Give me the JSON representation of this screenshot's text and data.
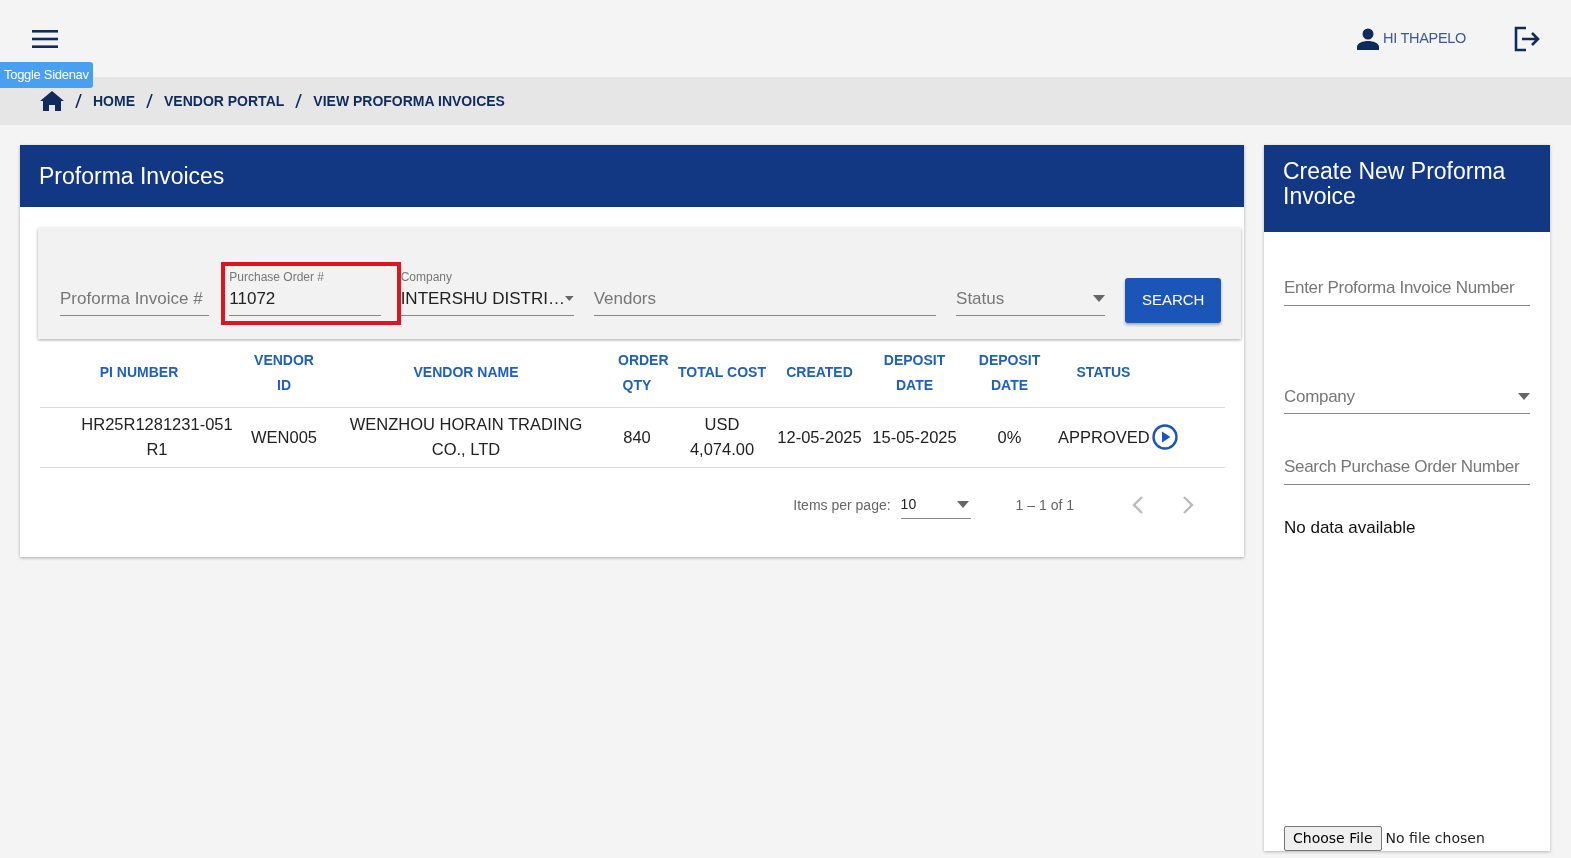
{
  "topbar": {
    "tooltip": "Toggle Sidenav",
    "user": "HI THAPELO"
  },
  "breadcrumb": [
    "HOME",
    "VENDOR PORTAL",
    "VIEW PROFORMA INVOICES"
  ],
  "invoices": {
    "title": "Proforma Invoices",
    "filters": [
      {
        "kind": "input",
        "placeholder": "Proforma Invoice #",
        "highlighted": false
      },
      {
        "kind": "input",
        "label": "Purchase Order #",
        "value": "11072",
        "highlighted": true
      },
      {
        "kind": "select",
        "label": "Company",
        "value": "INTERSHU DISTRI…",
        "highlighted": false
      },
      {
        "kind": "input",
        "placeholder": "Vendors",
        "highlighted": false
      },
      {
        "kind": "select",
        "placeholder": "Status",
        "highlighted": false
      }
    ],
    "search_button": "SEARCH",
    "table": {
      "columns": [
        "PI NUMBER",
        "VENDOR ID",
        "VENDOR NAME",
        "ORDER QTY",
        "TOTAL COST",
        "CREATED",
        "DEPOSIT DATE",
        "DEPOSIT DATE",
        "STATUS"
      ],
      "rows": [
        {
          "cells": [
            "HR25R1281231-051 R1",
            "WEN005",
            "WENZHOU HORAIN TRADING CO., LTD",
            "840",
            "USD 4,074.00",
            "12-05-2025",
            "15-05-2025",
            "0%",
            "APPROVED"
          ]
        }
      ]
    },
    "pagination": {
      "label": "Items per page:",
      "page_size": "10",
      "range": "1 – 1 of 1",
      "prev_disabled": true,
      "next_disabled": true
    }
  },
  "create": {
    "title": "Create New Proforma Invoice",
    "fields": [
      {
        "kind": "input",
        "placeholder": "Enter Proforma Invoice Number"
      },
      {
        "kind": "select",
        "placeholder": "Company"
      },
      {
        "kind": "input",
        "placeholder": "Search Purchase Order Number"
      }
    ],
    "empty_text": "No data available",
    "file_button": "Choose File",
    "file_status": "No file chosen"
  }
}
